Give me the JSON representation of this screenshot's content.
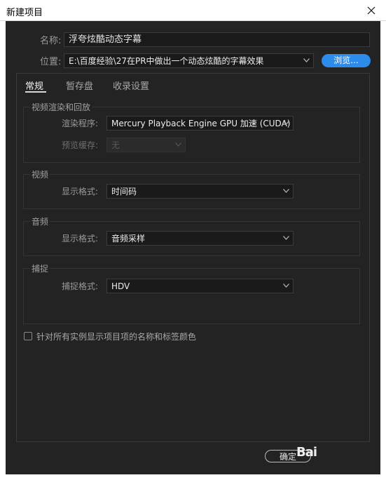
{
  "window": {
    "title": "新建项目"
  },
  "name_row": {
    "label": "名称:",
    "value": "浮夸炫酷动态字幕"
  },
  "location_row": {
    "label": "位置:",
    "value": "E:\\百度经验\\27在PR中做出一个动态炫酷的字幕效果",
    "browse_label": "浏览..."
  },
  "tabs": [
    {
      "label": "常规",
      "active": true
    },
    {
      "label": "暂存盘",
      "active": false
    },
    {
      "label": "收录设置",
      "active": false
    }
  ],
  "video_rendering": {
    "title": "视频渲染和回放",
    "renderer_label": "渲染程序:",
    "renderer_value": "Mercury Playback Engine GPU 加速 (CUDA)",
    "preview_cache_label": "预览缓存:",
    "preview_cache_value": "无"
  },
  "video": {
    "title": "视频",
    "format_label": "显示格式:",
    "format_value": "时间码"
  },
  "audio": {
    "title": "音频",
    "format_label": "显示格式:",
    "format_value": "音频采样"
  },
  "capture": {
    "title": "捕捉",
    "format_label": "捕捉格式:",
    "format_value": "HDV"
  },
  "checkbox": {
    "label": "针对所有实例显示项目项的名称和标签颜色",
    "checked": false
  },
  "buttons": {
    "ok": "确定"
  },
  "watermark": {
    "text": "Bai"
  },
  "colors": {
    "accent": "#2d8ceb",
    "background": "#232323",
    "field": "#1a1a1a"
  }
}
